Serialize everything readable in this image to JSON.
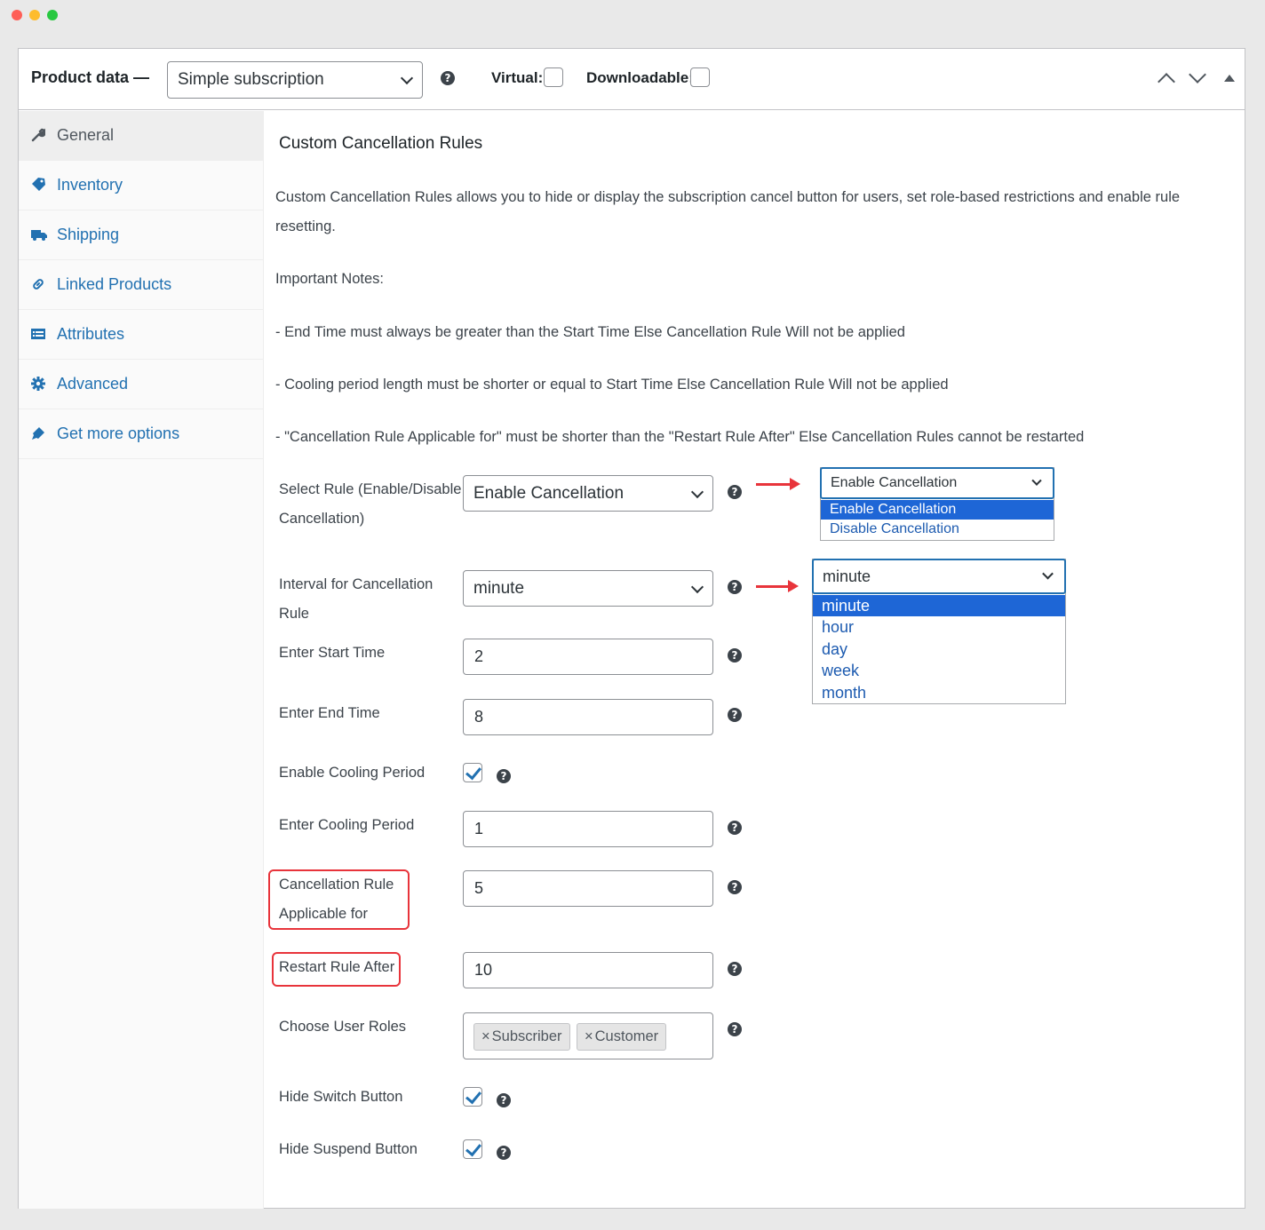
{
  "window": {
    "controls": [
      "close",
      "minimize",
      "maximize"
    ]
  },
  "header": {
    "title": "Product data —",
    "product_type": "Simple subscription",
    "help": "?",
    "virtual_label": "Virtual:",
    "downloadable_label": "Downloadable:",
    "virtual_checked": false,
    "downloadable_checked": false
  },
  "sidebar": {
    "items": [
      {
        "label": "General",
        "icon": "wrench-icon",
        "active": true
      },
      {
        "label": "Inventory",
        "icon": "tag-icon"
      },
      {
        "label": "Shipping",
        "icon": "truck-icon"
      },
      {
        "label": "Linked Products",
        "icon": "link-icon"
      },
      {
        "label": "Attributes",
        "icon": "list-icon"
      },
      {
        "label": "Advanced",
        "icon": "gear-icon"
      },
      {
        "label": "Get more options",
        "icon": "plugin-icon"
      }
    ]
  },
  "main": {
    "section_title": "Custom Cancellation Rules",
    "description_line1": "Custom Cancellation Rules allows you to hide or display the subscription cancel button for users, set role-based restrictions and enable rule",
    "description_line2": "resetting.",
    "notes_title": "Important Notes:",
    "note1": "- End Time must always be greater than the Start Time Else Cancellation Rule Will not be applied",
    "note2": "- Cooling period length must be shorter or equal to Start Time Else Cancellation Rule Will not be applied",
    "note3": "- \"Cancellation Rule Applicable for\" must be shorter than the \"Restart Rule After\" Else Cancellation Rules cannot be restarted",
    "fields": {
      "select_rule": {
        "label_line1": "Select Rule (Enable/Disable",
        "label_line2": "Cancellation)",
        "value": "Enable Cancellation"
      },
      "interval": {
        "label_line1": "Interval for Cancellation",
        "label_line2": "Rule",
        "value": "minute"
      },
      "start_time": {
        "label": "Enter Start Time",
        "value": "2"
      },
      "end_time": {
        "label": "Enter End Time",
        "value": "8"
      },
      "cooling_enabled": {
        "label": "Enable Cooling Period",
        "checked": true
      },
      "cooling_period": {
        "label": "Enter Cooling Period",
        "value": "1"
      },
      "applicable_for": {
        "label_line1": "Cancellation Rule",
        "label_line2": "Applicable for",
        "value": "5"
      },
      "restart_after": {
        "label": "Restart Rule After",
        "value": "10"
      },
      "user_roles": {
        "label": "Choose User Roles",
        "tags": [
          "Subscriber",
          "Customer"
        ],
        "remove_glyph": "×"
      },
      "hide_switch": {
        "label": "Hide Switch Button",
        "checked": true
      },
      "hide_suspend": {
        "label": "Hide Suspend Button",
        "checked": true
      }
    }
  },
  "callouts": {
    "rule_dropdown": {
      "selected": "Enable Cancellation",
      "options": [
        "Enable Cancellation",
        "Disable Cancellation"
      ],
      "highlighted": "Enable Cancellation"
    },
    "interval_dropdown": {
      "selected": "minute",
      "options": [
        "minute",
        "hour",
        "day",
        "week",
        "month"
      ],
      "highlighted": "minute"
    }
  },
  "colors": {
    "link": "#2271b1",
    "highlight": "#1e66d6",
    "callout_red": "#e8343b"
  }
}
